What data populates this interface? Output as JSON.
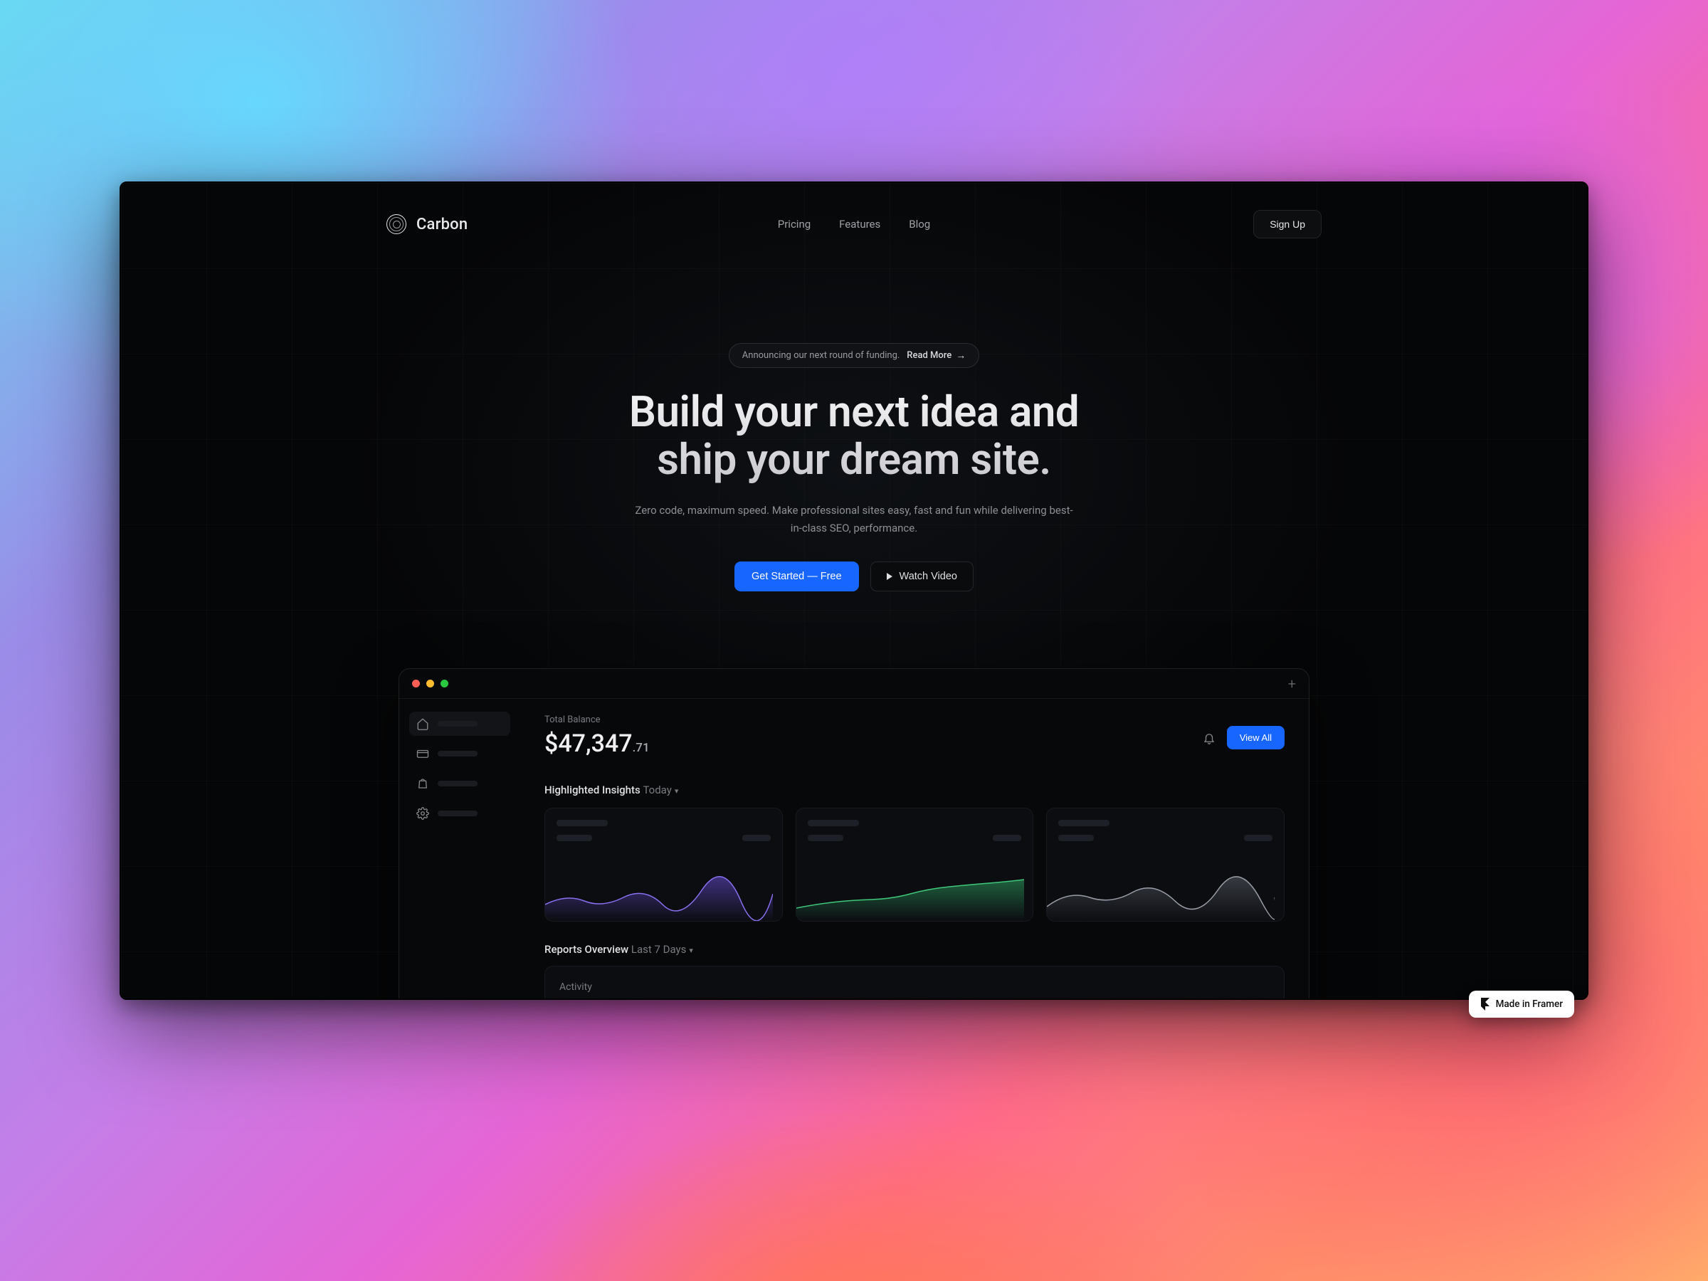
{
  "brand": {
    "name": "Carbon"
  },
  "nav": {
    "links": [
      {
        "label": "Pricing"
      },
      {
        "label": "Features"
      },
      {
        "label": "Blog"
      }
    ],
    "signup": "Sign Up"
  },
  "announcement": {
    "text": "Announcing our next round of funding.",
    "cta": "Read More"
  },
  "hero": {
    "title_line1": "Build your next idea and",
    "title_line2": "ship your dream site.",
    "subtitle": "Zero code, maximum speed. Make professional sites easy, fast and fun while delivering best-in-class SEO, performance.",
    "primary_cta": "Get Started — Free",
    "secondary_cta": "Watch Video"
  },
  "product": {
    "balance_label": "Total Balance",
    "balance_main": "$47,347",
    "balance_cents": ".71",
    "view_all": "View All",
    "insights_title": "Highlighted Insights",
    "insights_scope": "Today",
    "reports_title": "Reports Overview",
    "reports_scope": "Last 7 Days",
    "activity_label": "Activity",
    "sidebar_icons": [
      "home-icon",
      "card-icon",
      "bag-icon",
      "gear-icon"
    ]
  },
  "badge": {
    "made_in": "Made in Framer"
  },
  "colors": {
    "accent": "#1766ff",
    "insight_purple": "#6b4ed8",
    "insight_green": "#2fa563",
    "insight_gray": "#7a7e88"
  }
}
